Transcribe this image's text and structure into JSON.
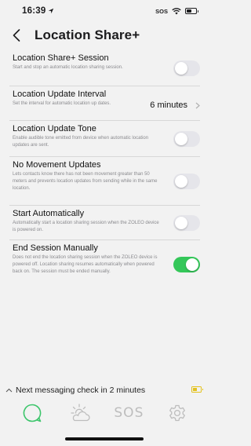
{
  "status_bar": {
    "time": "16:39",
    "sos_label": "SOS"
  },
  "header": {
    "title": "Location Share+"
  },
  "settings": [
    {
      "title": "Location Share+ Session",
      "description": "Start and stop an automatic location sharing session.",
      "control": "toggle",
      "enabled": false
    },
    {
      "title": "Location Update Interval",
      "description": "Set the interval for automatic location up dates.",
      "control": "value",
      "value": "6 minutes"
    },
    {
      "title": "Location Update Tone",
      "description": "Enable audible tone emitted from device when automatic location updates are sent.",
      "control": "toggle",
      "enabled": false
    },
    {
      "title": "No Movement Updates",
      "description": "Lets contacts know there has not been movement greater than 50 meters and prevents location updates from sending while in the same location.",
      "control": "toggle",
      "enabled": false
    },
    {
      "title": "Start Automatically",
      "description": "Automatically start a location sharing session when the ZOLEO device is powered on.",
      "control": "toggle",
      "enabled": false
    },
    {
      "title": "End Session Manually",
      "description": "Does not end the location sharing session when the ZOLEO device is powered off. Location sharing resumes automatically when powered back on. The session must be ended manually.",
      "control": "toggle",
      "enabled": true
    }
  ],
  "bottom": {
    "messaging_check": "Next messaging check in 2 minutes",
    "device_battery_level": 0.5
  },
  "tabs": [
    {
      "name": "messages",
      "icon": "chat-bubble-icon"
    },
    {
      "name": "weather",
      "icon": "weather-icon"
    },
    {
      "name": "sos",
      "icon": "sos-icon",
      "label": "SOS"
    },
    {
      "name": "settings",
      "icon": "gear-icon"
    }
  ],
  "colors": {
    "toggle_on": "#34c759",
    "toggle_off": "#e5e5ea",
    "accent": "#3cc56b",
    "device_battery": "#e4c21e",
    "background": "#f2f2f2"
  }
}
